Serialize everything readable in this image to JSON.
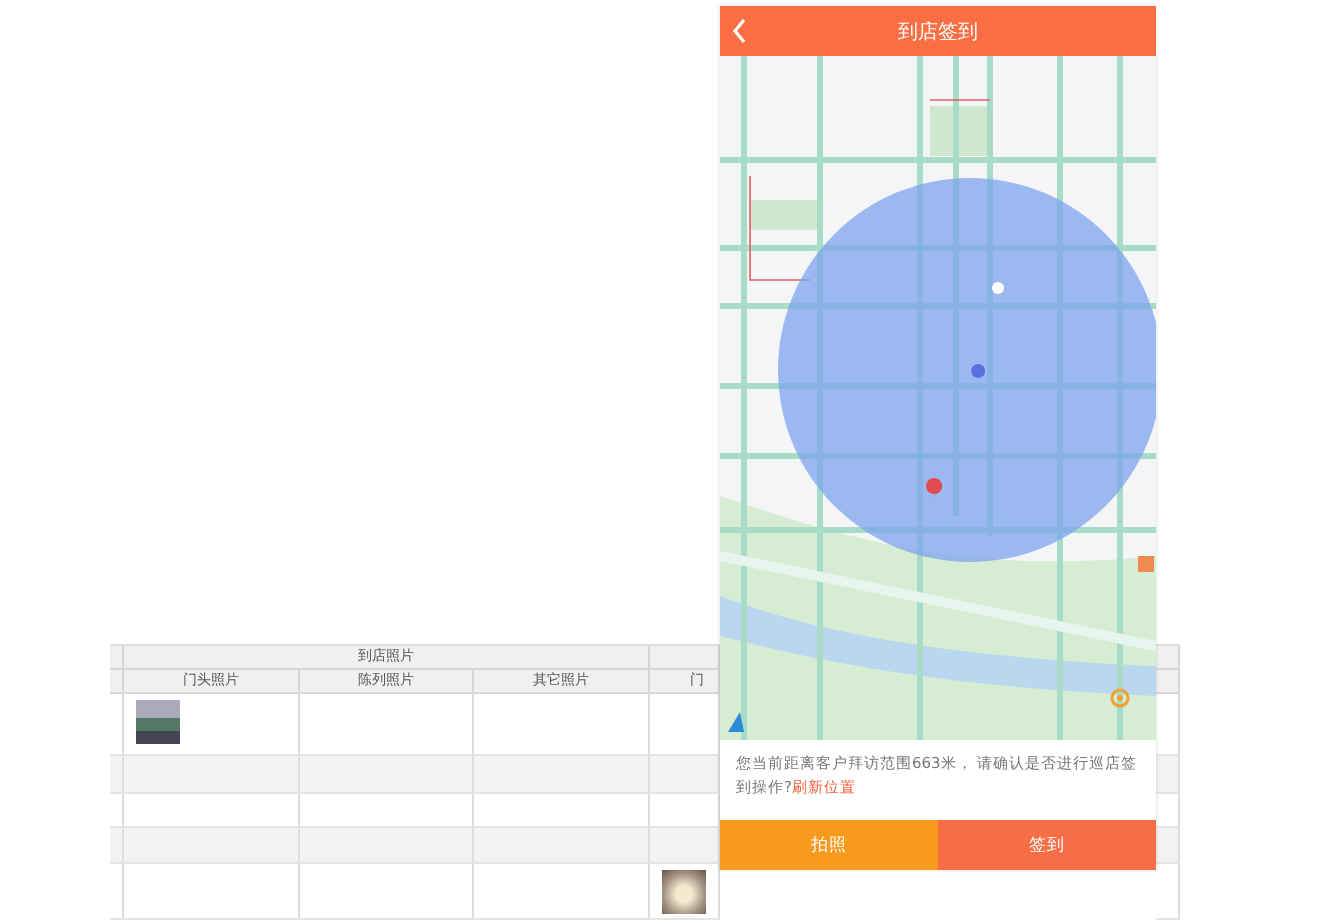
{
  "table": {
    "group_header": "到店照片",
    "columns": [
      "门头照片",
      "陈列照片",
      "其它照片",
      "门"
    ],
    "rows": [
      {
        "shaded": false,
        "cells": [
          {
            "photo": true
          },
          {
            "photo": false
          },
          {
            "photo": false
          },
          {
            "photo": false
          }
        ]
      },
      {
        "shaded": true,
        "cells": [
          {
            "photo": false
          },
          {
            "photo": false
          },
          {
            "photo": false
          },
          {
            "photo": false
          }
        ]
      },
      {
        "shaded": false,
        "cells": [
          {
            "photo": false
          },
          {
            "photo": false
          },
          {
            "photo": false
          },
          {
            "photo": false
          }
        ]
      },
      {
        "shaded": true,
        "cells": [
          {
            "photo": false
          },
          {
            "photo": false
          },
          {
            "photo": false
          },
          {
            "photo": false
          }
        ]
      },
      {
        "shaded": false,
        "cells": [
          {
            "photo": false
          },
          {
            "photo": false
          },
          {
            "photo": false
          },
          {
            "photo": true
          }
        ]
      }
    ]
  },
  "phone": {
    "title": "到店签到",
    "notice": "您当前距离客户拜访范围663米， 请确认是否进行巡店签到操作?",
    "refresh_link": "刷新位置",
    "buttons": [
      {
        "label": "拍照",
        "kind": "photo"
      },
      {
        "label": "签到",
        "kind": "checkin"
      }
    ]
  }
}
